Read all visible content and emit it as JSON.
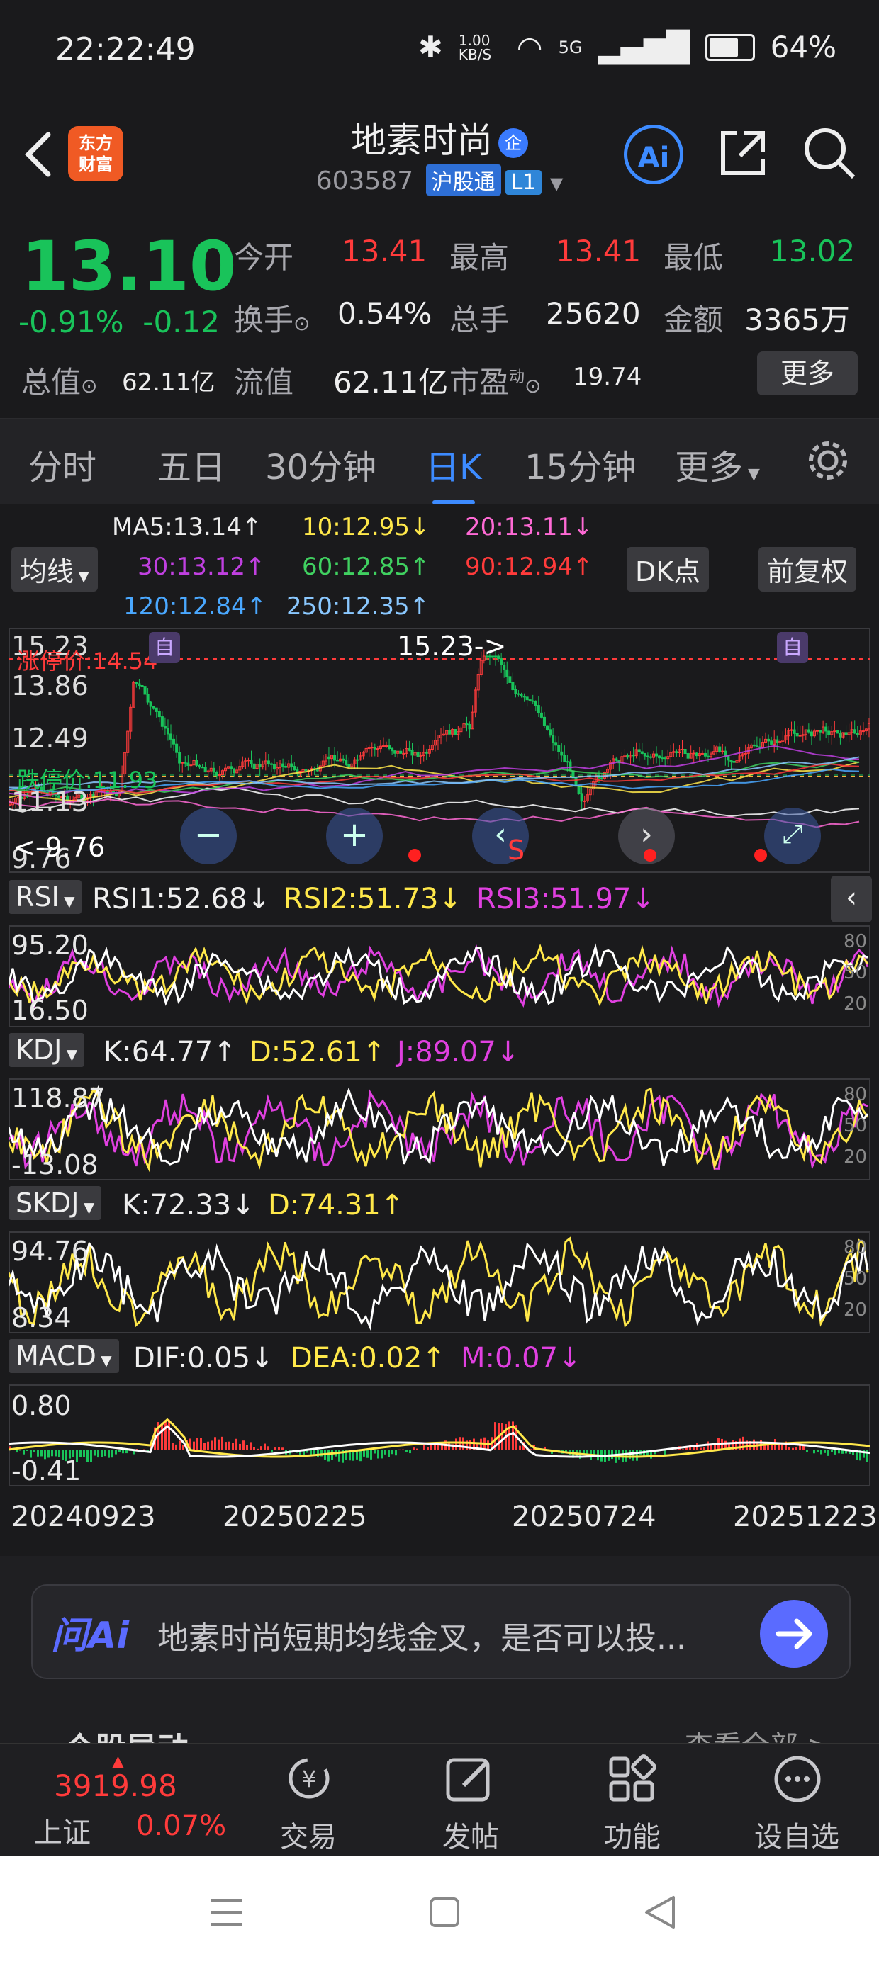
{
  "status_bar": {
    "time": "22:22:49",
    "net_speed": "1.00 KB/S",
    "signal": "5G",
    "battery": "64%"
  },
  "header": {
    "logo_line1": "东方",
    "logo_line2": "财富",
    "title": "地素时尚",
    "title_badge": "企",
    "code": "603587",
    "connect": "沪股通",
    "level": "L1"
  },
  "quote": {
    "price": "13.10",
    "pct_change": "-0.91%",
    "change": "-0.12",
    "open_label": "今开",
    "open": "13.41",
    "high_label": "最高",
    "high": "13.41",
    "low_label": "最低",
    "low": "13.02",
    "turnover_label": "换手",
    "turnover": "0.54%",
    "volume_label": "总手",
    "volume": "25620",
    "amount_label": "金额",
    "amount": "3365万",
    "mktcap_label": "总值",
    "mktcap": "62.11亿",
    "float_label": "流值",
    "float": "62.11亿",
    "pe_label": "市盈",
    "pe_sup": "动",
    "pe": "19.74",
    "more_button": "更多"
  },
  "tabs": [
    "分时",
    "五日",
    "30分钟",
    "日K",
    "15分钟",
    "更多"
  ],
  "active_tab": "日K",
  "ma": {
    "selector": "均线",
    "ma5": "MA5:13.14↑",
    "ma10": "10:12.95↓",
    "ma20": "20:13.11↓",
    "ma30": "30:13.12↑",
    "ma60": "60:12.85↑",
    "ma90": "90:12.94↑",
    "ma120": "120:12.84↑",
    "ma250": "250:12.35↑",
    "dk_button": "DK点",
    "adjust_button": "前复权"
  },
  "kline": {
    "y_ticks": [
      "15.23",
      "13.86",
      "12.49",
      "11.13",
      "9.76"
    ],
    "limit_up": "涨停价:14.54",
    "limit_down": "跌停价:11.93",
    "max_marker": "15.23->",
    "min_marker": "<-9.76",
    "self_tag": "自",
    "s_marker": "S"
  },
  "rsi": {
    "label": "RSI",
    "rsi1": "RSI1:52.68↓",
    "rsi2": "RSI2:51.73↓",
    "rsi3": "RSI3:51.97↓",
    "top": "95.20",
    "bottom": "16.50",
    "r80": "80",
    "r50": "50",
    "r20": "20"
  },
  "kdj": {
    "label": "KDJ",
    "k": "K:64.77↑",
    "d": "D:52.61↑",
    "j": "J:89.07↓",
    "top": "118.87",
    "bottom": "-13.08",
    "r80": "80",
    "r50": "50",
    "r20": "20"
  },
  "skdj": {
    "label": "SKDJ",
    "k": "K:72.33↓",
    "d": "D:74.31↑",
    "top": "94.76",
    "bottom": "8.34",
    "r80": "80",
    "r50": "50",
    "r20": "20"
  },
  "macd": {
    "label": "MACD",
    "dif": "DIF:0.05↓",
    "dea": "DEA:0.02↑",
    "m": "M:0.07↓",
    "top": "0.80",
    "bottom": "-0.41"
  },
  "dates": [
    "20240923",
    "20250225",
    "20250724",
    "20251223"
  ],
  "chat": {
    "ai_label": "问Ai",
    "placeholder": "地素时尚短期均线金叉，是否可以投..."
  },
  "partial_section": {
    "title": "个股异动",
    "link": "查看全部 >"
  },
  "bottom_bar": {
    "index_value": "3919.98",
    "index_name": "上证",
    "index_change": "0.07%",
    "items": [
      "交易",
      "发帖",
      "功能",
      "设自选"
    ]
  },
  "colors": {
    "up": "#ff3b3b",
    "down": "#19c35a",
    "accent": "#3d8bff",
    "yellow": "#ffe84a",
    "magenta": "#e040e0"
  }
}
